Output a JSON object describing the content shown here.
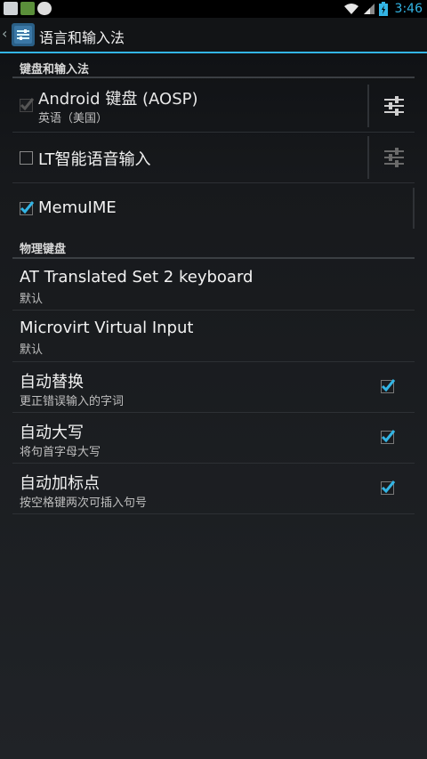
{
  "status_bar": {
    "time": "3:46"
  },
  "action_bar": {
    "title": "语言和输入法"
  },
  "sections": {
    "keyboard": {
      "header": "键盘和输入法",
      "items": [
        {
          "title": "Android 键盘 (AOSP)",
          "subtitle": "英语（美国）",
          "checked": true,
          "enabled": false
        },
        {
          "title": "LT智能语音输入",
          "checked": false
        },
        {
          "title": "MemuIME",
          "checked": true
        }
      ]
    },
    "physical": {
      "header": "物理键盘",
      "items": [
        {
          "title": "AT Translated Set 2 keyboard",
          "subtitle": "默认"
        },
        {
          "title": "Microvirt Virtual Input",
          "subtitle": "默认"
        }
      ]
    },
    "options": [
      {
        "title": "自动替换",
        "subtitle": "更正错误输入的字词",
        "checked": true
      },
      {
        "title": "自动大写",
        "subtitle": "将句首字母大写",
        "checked": true
      },
      {
        "title": "自动加标点",
        "subtitle": "按空格键两次可插入句号",
        "checked": true
      }
    ]
  },
  "colors": {
    "accent": "#33b5e5"
  }
}
